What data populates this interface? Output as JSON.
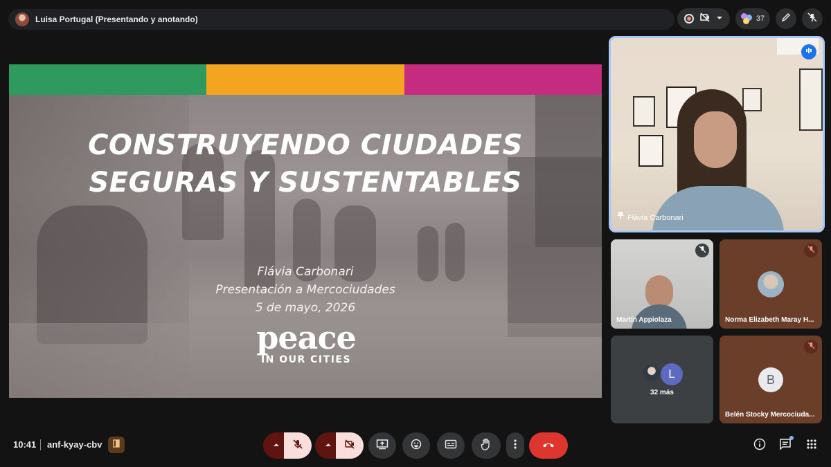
{
  "header": {
    "presenter_text": "Luisa Portugal (Presentando y anotando)",
    "participant_count": "37"
  },
  "slide": {
    "title_line1": "CONSTRUYENDO CIUDADES",
    "title_line2": "SEGURAS Y SUSTENTABLES",
    "author": "Flávia Carbonari",
    "event": "Presentación a Mercociudades",
    "date": "5 de mayo, 2026",
    "logo_main": "peace",
    "logo_sub": "IN OUR CITIES",
    "bar_colors": [
      "#2e9a5e",
      "#f3a522",
      "#c42d7f"
    ]
  },
  "tiles": {
    "main": {
      "name": "Flávia Carbonari"
    },
    "t1": {
      "name": "Martín Appiolaza"
    },
    "t2": {
      "name": "Norma Elizabeth Maray H..."
    },
    "t3": {
      "more": "32 más",
      "avatar_letter": "L"
    },
    "t4": {
      "name": "Belén Stocky Mercociuda...",
      "avatar_letter": "B"
    }
  },
  "footer": {
    "time": "10:41",
    "meeting_code": "anf-kyay-cbv"
  },
  "colors": {
    "accent_blue": "#a8c7fa",
    "end_call": "#dc362e",
    "muted_bg": "#f9dedc"
  }
}
